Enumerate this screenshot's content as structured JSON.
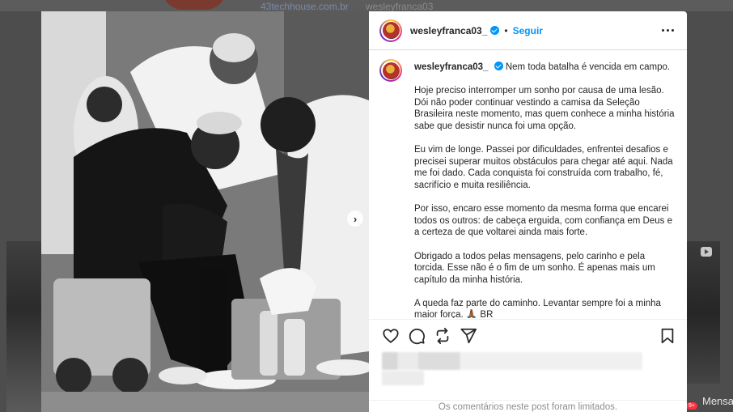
{
  "background": {
    "top_link": "43techhouse.com.br",
    "top_user": "wesleyfranca03",
    "messages_label": "Mensa",
    "messages_badge": "9+"
  },
  "post": {
    "username": "wesleyfranca03_",
    "follow_label": "Seguir",
    "separator": "•",
    "caption_first_line": "Nem toda batalha é vencida em campo.",
    "caption_paragraphs": [
      "Hoje preciso interromper um sonho por causa de uma lesão. Dói não poder continuar vestindo a camisa da Seleção Brasileira neste momento, mas quem conhece a minha história sabe que desistir nunca foi uma opção.",
      "Eu vim de longe. Passei por dificuldades, enfrentei desafios e precisei superar muitos obstáculos para chegar até aqui. Nada me foi dado. Cada conquista foi construída com trabalho, fé, sacrifício e muita resiliência.",
      "Por isso, encaro esse momento da mesma forma que encarei todos os outros: de cabeça erguida, com confiança em Deus e a certeza de que voltarei ainda mais forte.",
      "Obrigado a todos pelas mensagens, pelo carinho e pela torcida. Esse não é o fim de um sonho. É apenas mais um capítulo da minha história.",
      "A queda faz parte do caminho. Levantar sempre foi a minha maior força. 🙏🏾 BR"
    ],
    "comments_limited": "Os comentários neste post foram limitados.",
    "carousel_next": "›"
  },
  "icons": {
    "verified": "verified-badge-icon",
    "more": "more-options-icon",
    "like": "heart-icon",
    "comment": "comment-icon",
    "share": "repost-icon",
    "send": "send-icon",
    "save": "bookmark-icon"
  },
  "colors": {
    "accent": "#0095f6",
    "text": "#262626",
    "muted": "#8e8e8e"
  }
}
